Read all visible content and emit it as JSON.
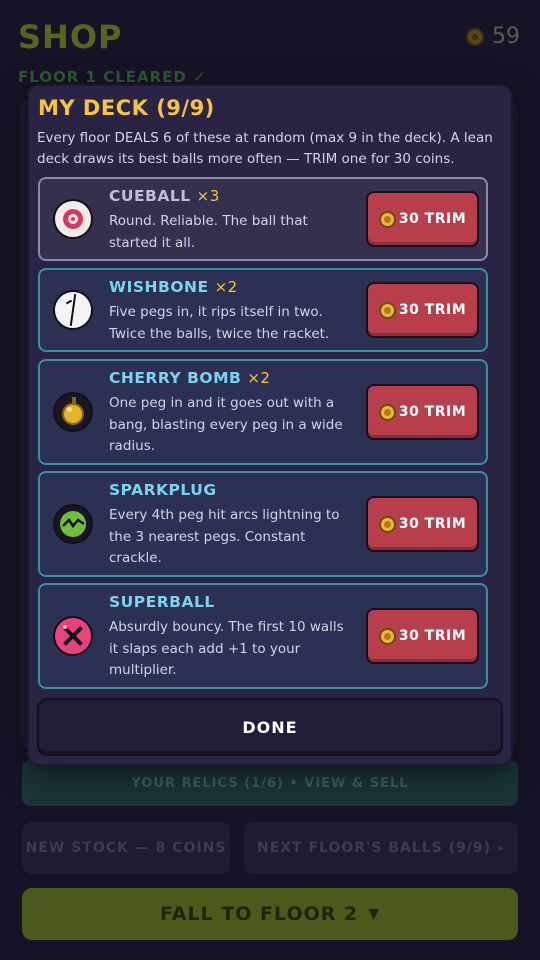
{
  "shop": {
    "title": "SHOP",
    "coins": "59",
    "floor_status": "FLOOR 1 CLEARED",
    "relics_label": "YOUR RELICS (1/6) • VIEW & SELL",
    "new_stock_label": "NEW STOCK — 8 COINS",
    "next_balls_label": "NEXT FLOOR'S BALLS (9/9)",
    "fall_label": "FALL TO FLOOR 2"
  },
  "deck": {
    "title": "MY DECK (9/9)",
    "description": "Every floor DEALS 6 of these at random (max 9 in the deck). A lean deck draws its best balls more often — TRIM one for 30 coins.",
    "trim_label": "30 TRIM",
    "done_label": "DONE",
    "balls": [
      {
        "name": "CUEBALL",
        "count": "×3",
        "desc": "Round. Reliable. The ball that started it all.",
        "icon": "cueball-icon"
      },
      {
        "name": "WISHBONE",
        "count": "×2",
        "desc": "Five pegs in, it rips itself in two. Twice the balls, twice the racket.",
        "icon": "wishbone-icon"
      },
      {
        "name": "CHERRY BOMB",
        "count": "×2",
        "desc": "One peg in and it goes out with a bang, blasting every peg in a wide radius.",
        "icon": "cherry-bomb-icon"
      },
      {
        "name": "SPARKPLUG",
        "count": "",
        "desc": "Every 4th peg hit arcs lightning to the 3 nearest pegs. Constant crackle.",
        "icon": "sparkplug-icon"
      },
      {
        "name": "SUPERBALL",
        "count": "",
        "desc": "Absurdly bouncy. The first 10 walls it slaps each add +1 to your multiplier.",
        "icon": "superball-icon"
      }
    ]
  },
  "colors": {
    "accent_gold": "#f6c53b",
    "ball_name_cyan": "#7bd3ef",
    "trim_red": "#b83e4c",
    "modal_bg": "#2a2444"
  }
}
